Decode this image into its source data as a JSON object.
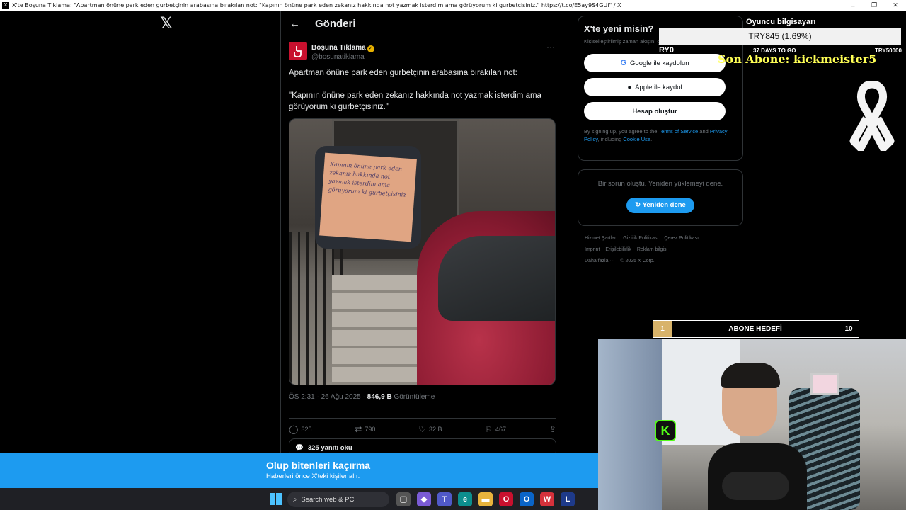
{
  "window": {
    "title": "X'te Boşuna Tıklama: \"Apartman önüne park eden gurbetçinin arabasına bırakılan not: \"Kapının önüne park eden zekanız hakkında not yazmak isterdim ama görüyorum ki gurbetçisiniz.\" https://t.co/E5ay9S4GUi\" / X",
    "minimize": "–",
    "maximize": "❐",
    "close": "✕"
  },
  "nav": {
    "logo": "𝕏"
  },
  "post": {
    "back_icon": "←",
    "header": "Gönderi",
    "author_name": "Boşuna Tıklama",
    "verified_mark": "✓",
    "author_handle": "@bosunatiklama",
    "more_icon": "···",
    "text_line1": "Apartman önüne park eden gurbetçinin arabasına bırakılan not:",
    "text_line2": "\"Kapının önüne park eden zekanız hakkında not yazmak isterdim ama görüyorum ki gurbetçisiniz.\"",
    "note_handwriting": "Kapının önüne park eden zekanız hakkında not yazmak isterdim ama görüyorum ki gurbetçisiniz",
    "time": "ÖS 2:31 · 26 Ağu 2025 · ",
    "views_count": "846,9 B",
    "views_label": " Görüntüleme",
    "actions": {
      "reply_icon": "◯",
      "replies": "325",
      "repost_icon": "⇄",
      "reposts": "790",
      "like_icon": "♡",
      "likes": "32 B",
      "bookmark_icon": "⚐",
      "bookmarks": "467",
      "share_icon": "⇪"
    },
    "read_replies": "325 yanıtı oku"
  },
  "signup": {
    "title": "X'te yeni misin?",
    "subtitle": "Kişiselleştirilmiş zaman akışını görmek için hemen kaydol!",
    "google": "Google ile kaydolun",
    "apple": "Apple ile kaydol",
    "create": "Hesap oluştur",
    "terms_prefix": "By signing up, you agree to the ",
    "terms_link": "Terms of Service",
    "terms_and": " and ",
    "privacy_link": "Privacy Policy",
    "terms_including": ", including ",
    "cookie_link": "Cookie Use",
    "terms_end": "."
  },
  "error": {
    "message": "Bir sorun oluştu. Yeniden yüklemeyi dene.",
    "retry": "Yeniden dene"
  },
  "footer": {
    "links": [
      "Hizmet Şartları",
      "Gizlilik Politikası",
      "Çerez Politikası",
      "Imprint",
      "Erişilebilirlik",
      "Reklam bilgisi",
      "Daha fazla ···",
      "© 2025 X Corp."
    ]
  },
  "overlay": {
    "goal_title": "Oyuncu bilgisayarı",
    "goal_value": "TRY845 (1.69%)",
    "goal_start": "RY0",
    "days_to_go": "37 DAYS TO GO",
    "goal_max": "TRY50000",
    "goal_progress": 0.0169,
    "last_sub": "Son Abone: kickmeister5",
    "abone_current": "1",
    "abone_label": "ABONE HEDEFİ",
    "abone_target": "10",
    "kick_logo": "K"
  },
  "banner": {
    "title": "Olup bitenleri kaçırma",
    "subtitle": "Haberleri önce X'teki kişiler alır."
  },
  "taskbar": {
    "search_icon": "⌕",
    "search_label": "Search web & PC",
    "colors": {
      "accent": "#1d9bf0",
      "kick": "#53fc18"
    }
  }
}
